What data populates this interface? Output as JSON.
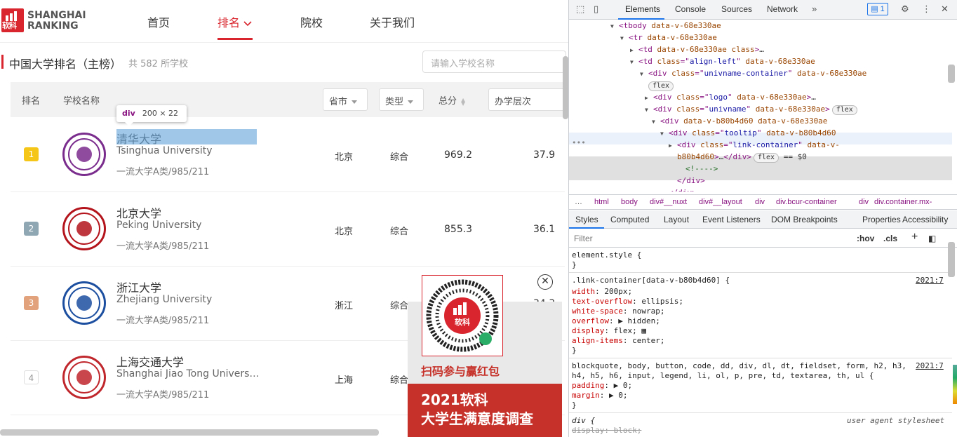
{
  "site": {
    "logo_text_1": "SHANGHAI",
    "logo_text_2": "RANKING",
    "logo_cn": "软科",
    "nav": [
      "首页",
      "排名",
      "院校",
      "关于我们"
    ],
    "page_title": "中国大学排名（主榜）",
    "count_text": "共 582 所学校",
    "search_placeholder": "请输入学校名称",
    "headers": {
      "rank": "排名",
      "name": "学校名称",
      "province": "省市",
      "type": "类型",
      "score": "总分",
      "level": "办学层次"
    },
    "rows": [
      {
        "rank": "1",
        "cn": "清华大学",
        "en": "Tsinghua University",
        "tags": "一流大学A类/985/211",
        "province": "北京",
        "type": "综合",
        "score": "969.2",
        "level": "37.9",
        "rank_color": "#f5c518",
        "emblem_color": "#7b2d8e"
      },
      {
        "rank": "2",
        "cn": "北京大学",
        "en": "Peking University",
        "tags": "一流大学A类/985/211",
        "province": "北京",
        "type": "综合",
        "score": "855.3",
        "level": "36.1",
        "rank_color": "#8fa6b3",
        "emblem_color": "#b4141c"
      },
      {
        "rank": "3",
        "cn": "浙江大学",
        "en": "Zhejiang University",
        "tags": "一流大学A类/985/211",
        "province": "浙江",
        "type": "综合",
        "score": "",
        "level": "34.3",
        "rank_color": "#e2a27b",
        "emblem_color": "#1d4fa0"
      },
      {
        "rank": "4",
        "cn": "上海交通大学",
        "en": "Shanghai Jiao Tong University",
        "tags": "一流大学A类/985/211",
        "province": "上海",
        "type": "综合",
        "score": "",
        "level": "",
        "rank_color": "#ffffff",
        "emblem_color": "#c0272d"
      }
    ],
    "tooltip": {
      "tag": "div",
      "dims": "200 × 22"
    },
    "popup": {
      "cta": "扫码参与赢红包",
      "line1": "2021软科",
      "line2": "大学生满意度调查"
    },
    "accent": "#d9262e"
  },
  "devtools": {
    "tabs": [
      "Elements",
      "Console",
      "Sources",
      "Network"
    ],
    "badge": "1",
    "tree": [
      {
        "indent": 159,
        "arrow": "▼",
        "html": "<tbody <span class='an'>data-v-68e330ae</span>>"
      },
      {
        "indent": 173,
        "arrow": "▼",
        "html": "<tr <span class='an'>data-v-68e330ae</span>>"
      },
      {
        "indent": 187,
        "arrow": "▶",
        "html": "<td <span class='an'>data-v-68e330ae</span> <span class='an'>class</span>><span class='tx'>…</span></td>"
      },
      {
        "indent": 187,
        "arrow": "▼",
        "html": "<td <span class='an'>class</span>=\"<span class='av'>align-left</span>\" <span class='an'>data-v-68e330ae</span>>"
      },
      {
        "indent": 201,
        "arrow": "▼",
        "html": "<div <span class='an'>class</span>=\"<span class='av'>univname-container</span>\" <span class='an'>data-v-68e330ae</span>>"
      },
      {
        "indent": 198,
        "arrow": "",
        "html": "<span class='pill'>flex</span>"
      },
      {
        "indent": 208,
        "arrow": "▶",
        "html": "<div <span class='an'>class</span>=\"<span class='av'>logo</span>\" <span class='an'>data-v-68e330ae</span>><span class='tx'>…</span></div>"
      },
      {
        "indent": 208,
        "arrow": "▼",
        "html": "<div <span class='an'>class</span>=\"<span class='av'>univname</span>\" <span class='an'>data-v-68e330ae</span>><span class='pill'>flex</span>"
      },
      {
        "indent": 218,
        "arrow": "▼",
        "html": "<div <span class='an'>data-v-b80b4d60</span> <span class='an'>data-v-68e330ae</span>>"
      },
      {
        "indent": 230,
        "arrow": "▼",
        "html": "<div <span class='an'>class</span>=\"<span class='av'>tooltip</span>\" <span class='an'>data-v-b80b4d60</span>>"
      },
      {
        "indent": 242,
        "arrow": "▶",
        "html": "<div <span class='an'>class</span>=\"<span class='av'>link-container</span>\" <span class='an'>data-v-</span>"
      },
      {
        "indent": 242,
        "arrow": "",
        "html": "<span class='an'>b80b4d60</span>><span class='tx'>…</span></div><span class='pill'>flex</span> <span class='tx'>== $0</span>"
      },
      {
        "indent": 254,
        "arrow": "",
        "html": "<span style='color:#236e25'>&lt;!----&gt;</span>"
      },
      {
        "indent": 242,
        "arrow": "",
        "html": "</div>"
      },
      {
        "indent": 230,
        "arrow": "",
        "html": "</div>"
      }
    ],
    "crumbs": [
      "…",
      "html",
      "body",
      "div#__nuxt",
      "div#__layout",
      "div",
      "div.bcur-container",
      "div",
      "div.container.mx-"
    ],
    "style_tabs": [
      "Styles",
      "Computed",
      "Layout",
      "Event Listeners",
      "DOM Breakpoints",
      "Properties",
      "Accessibility"
    ],
    "filter_placeholder": "Filter",
    "filter_hov": ":hov",
    "filter_cls": ".cls",
    "css": [
      {
        "t": "element.style {",
        "src": ""
      },
      {
        "t": "}",
        "src": ""
      },
      {
        "t": ".link-container[data-v-b80b4d60] {",
        "src": "2021:7"
      },
      {
        "t": "  <span class='pn'>width</span>: 200px;",
        "src": ""
      },
      {
        "t": "  <span class='pn'>text-overflow</span>: ellipsis;",
        "src": ""
      },
      {
        "t": "  <span class='pn'>white-space</span>: nowrap;",
        "src": ""
      },
      {
        "t": "  <span class='pn'>overflow</span>: ▶ hidden;",
        "src": ""
      },
      {
        "t": "  <span class='pn'>display</span>: flex; ▦",
        "src": ""
      },
      {
        "t": "  <span class='pn'>align-items</span>: center;",
        "src": ""
      },
      {
        "t": "}",
        "src": ""
      },
      {
        "t": "blockquote, body, button, code, dd, div, dl, dt, fieldset, form, h2, h3,",
        "src": "2021:7"
      },
      {
        "t": "h4, h5, h6, input, legend, li, ol, p, pre, td, textarea, th, ul {",
        "src": ""
      },
      {
        "t": "  <span class='pn'>padding</span>: ▶ 0;",
        "src": ""
      },
      {
        "t": "  <span class='pn'>margin</span>: ▶ 0;",
        "src": ""
      },
      {
        "t": "}",
        "src": ""
      },
      {
        "t": "<i>div {</i>",
        "src": "user agent stylesheet"
      },
      {
        "t": "  <s style='color:#999'>display: block;</s>",
        "src": ""
      }
    ]
  }
}
